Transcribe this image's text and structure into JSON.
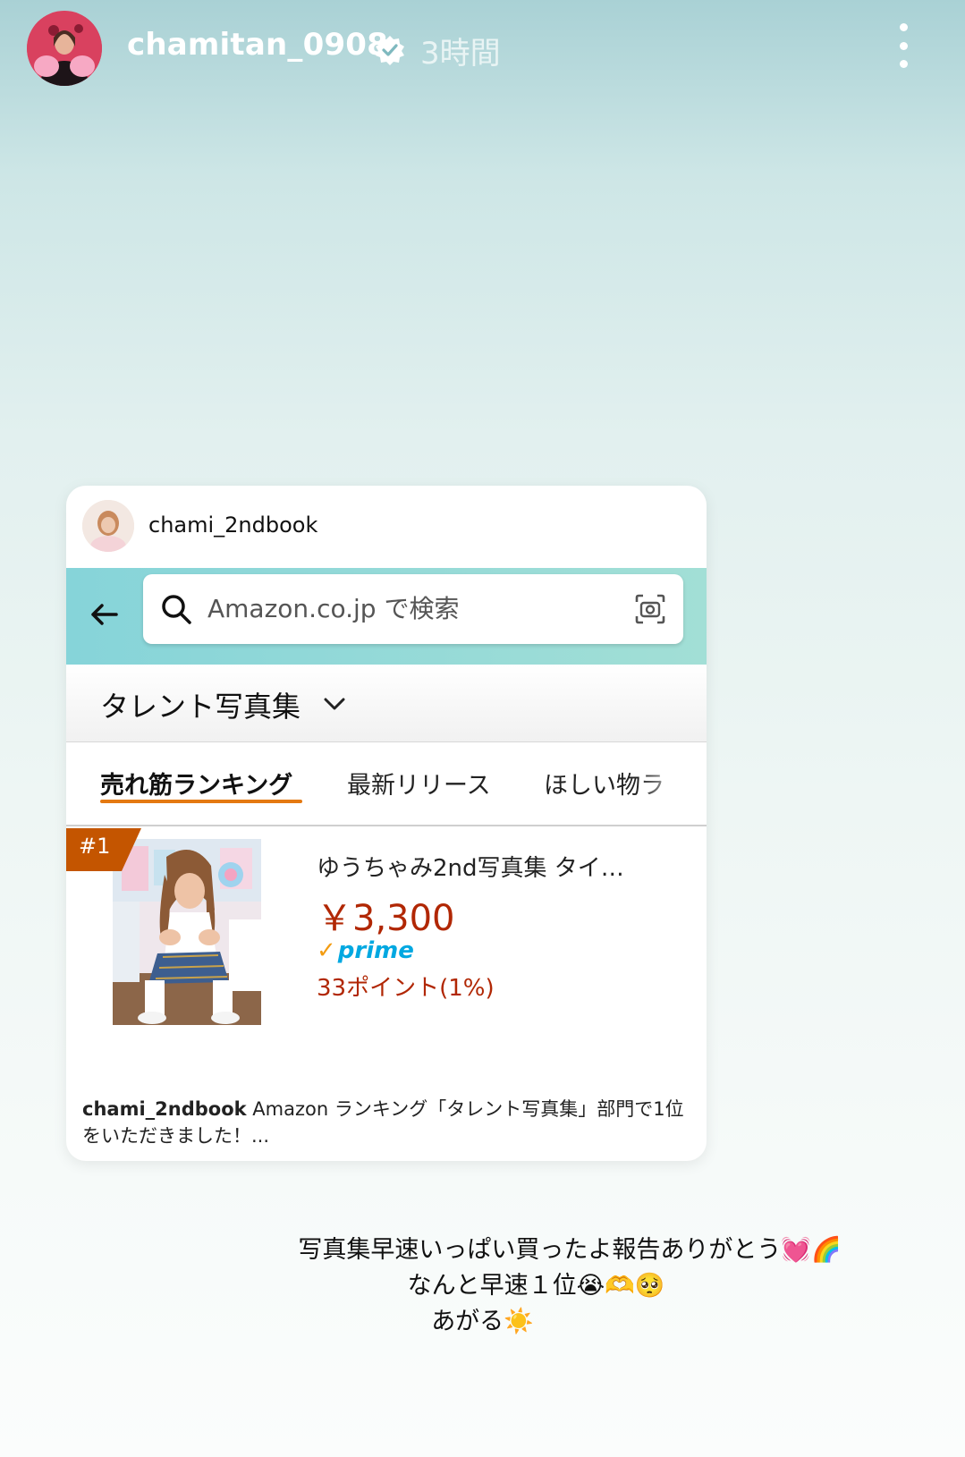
{
  "header": {
    "username": "chamitan_0908",
    "time": "3時間",
    "more_icon": "more-vertical-icon",
    "verified_icon": "verified-badge-icon"
  },
  "card": {
    "username": "chami_2ndbook",
    "search_placeholder": "Amazon.co.jp で検索",
    "category": "タレント写真集",
    "tabs": [
      {
        "label": "売れ筋ランキング",
        "active": true
      },
      {
        "label": "最新リリース",
        "active": false
      },
      {
        "label": "ほしい物ラ",
        "active": false
      }
    ],
    "product": {
      "rank": "#1",
      "title": "ゆうちゃみ2nd写真集 タイ…",
      "price": "￥3,300",
      "prime_check": "✓",
      "prime": "prime",
      "points": "33ポイント(1%)"
    },
    "caption_user": "chami_2ndbook",
    "caption_text": "Amazon ランキング「タレント写真集」部門で1位をいただきました！..."
  },
  "story_text": {
    "line1": "写真集早速いっぱい買ったよ報告ありがとう💓🌈",
    "line2": "なんと早速１位😭🫶🥺",
    "line3": "あがる☀️"
  },
  "colors": {
    "accent_orange": "#e47911",
    "price_red": "#b12704",
    "prime_blue": "#00a8e1",
    "amazon_bar": "#86d4d9"
  }
}
